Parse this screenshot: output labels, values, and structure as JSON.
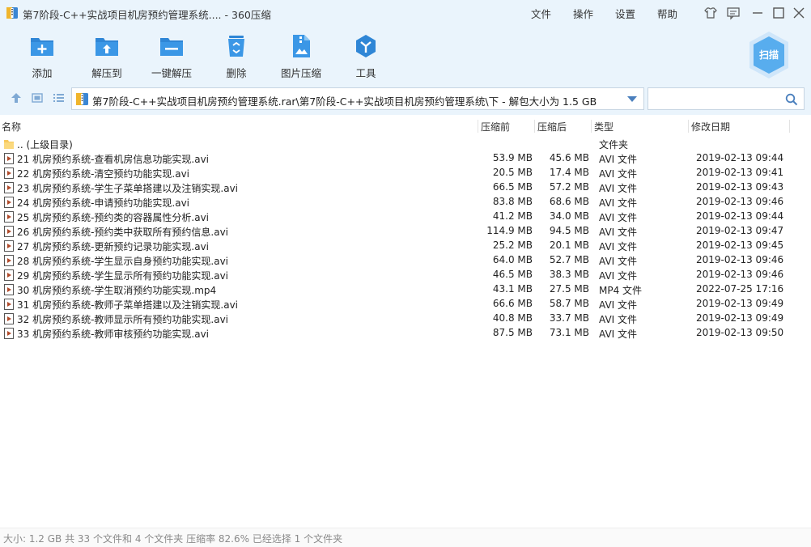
{
  "window": {
    "title": "第7阶段-C++实战项目机房预约管理系统.... - 360压缩",
    "menu": [
      "文件",
      "操作",
      "设置",
      "帮助"
    ]
  },
  "toolbar": {
    "add": "添加",
    "extract_to": "解压到",
    "one_click": "一键解压",
    "delete": "删除",
    "image_compress": "图片压缩",
    "tools": "工具",
    "scan": "扫描"
  },
  "address": {
    "path": "第7阶段-C++实战项目机房预约管理系统.rar\\第7阶段-C++实战项目机房预约管理系统\\下 - 解包大小为 1.5 GB",
    "search_placeholder": ""
  },
  "columns": {
    "name": "名称",
    "compressed_before": "压缩前",
    "compressed_after": "压缩后",
    "type": "类型",
    "modified": "修改日期"
  },
  "parent_row": {
    "name": ".. (上级目录)",
    "type": "文件夹"
  },
  "files": [
    {
      "name": "21 机房预约系统-查看机房信息功能实现.avi",
      "before": "53.9 MB",
      "after": "45.6 MB",
      "type": "AVI 文件",
      "date": "2019-02-13 09:44"
    },
    {
      "name": "22 机房预约系统-清空预约功能实现.avi",
      "before": "20.5 MB",
      "after": "17.4 MB",
      "type": "AVI 文件",
      "date": "2019-02-13 09:41"
    },
    {
      "name": "23 机房预约系统-学生子菜单搭建以及注销实现.avi",
      "before": "66.5 MB",
      "after": "57.2 MB",
      "type": "AVI 文件",
      "date": "2019-02-13 09:43"
    },
    {
      "name": "24 机房预约系统-申请预约功能实现.avi",
      "before": "83.8 MB",
      "after": "68.6 MB",
      "type": "AVI 文件",
      "date": "2019-02-13 09:46"
    },
    {
      "name": "25 机房预约系统-预约类的容器属性分析.avi",
      "before": "41.2 MB",
      "after": "34.0 MB",
      "type": "AVI 文件",
      "date": "2019-02-13 09:44"
    },
    {
      "name": "26 机房预约系统-预约类中获取所有预约信息.avi",
      "before": "114.9 MB",
      "after": "94.5 MB",
      "type": "AVI 文件",
      "date": "2019-02-13 09:47"
    },
    {
      "name": "27 机房预约系统-更新预约记录功能实现.avi",
      "before": "25.2 MB",
      "after": "20.1 MB",
      "type": "AVI 文件",
      "date": "2019-02-13 09:45"
    },
    {
      "name": "28 机房预约系统-学生显示自身预约功能实现.avi",
      "before": "64.0 MB",
      "after": "52.7 MB",
      "type": "AVI 文件",
      "date": "2019-02-13 09:46"
    },
    {
      "name": "29 机房预约系统-学生显示所有预约功能实现.avi",
      "before": "46.5 MB",
      "after": "38.3 MB",
      "type": "AVI 文件",
      "date": "2019-02-13 09:46"
    },
    {
      "name": "30 机房预约系统-学生取消预约功能实现.mp4",
      "before": "43.1 MB",
      "after": "27.5 MB",
      "type": "MP4 文件",
      "date": "2022-07-25 17:16"
    },
    {
      "name": "31 机房预约系统-教师子菜单搭建以及注销实现.avi",
      "before": "66.6 MB",
      "after": "58.7 MB",
      "type": "AVI 文件",
      "date": "2019-02-13 09:49"
    },
    {
      "name": "32 机房预约系统-教师显示所有预约功能实现.avi",
      "before": "40.8 MB",
      "after": "33.7 MB",
      "type": "AVI 文件",
      "date": "2019-02-13 09:49"
    },
    {
      "name": "33 机房预约系统-教师审核预约功能实现.avi",
      "before": "87.5 MB",
      "after": "73.1 MB",
      "type": "AVI 文件",
      "date": "2019-02-13 09:50"
    }
  ],
  "status": {
    "text": "大小: 1.2 GB 共 33 个文件和 4 个文件夹 压缩率 82.6% 已经选择 1 个文件夹"
  },
  "icons": {
    "app": "archive-icon",
    "folder": "folder-icon",
    "video": "video-file-icon"
  },
  "colors": {
    "accent": "#2f86d6",
    "chrome": "#eaf4fc"
  }
}
